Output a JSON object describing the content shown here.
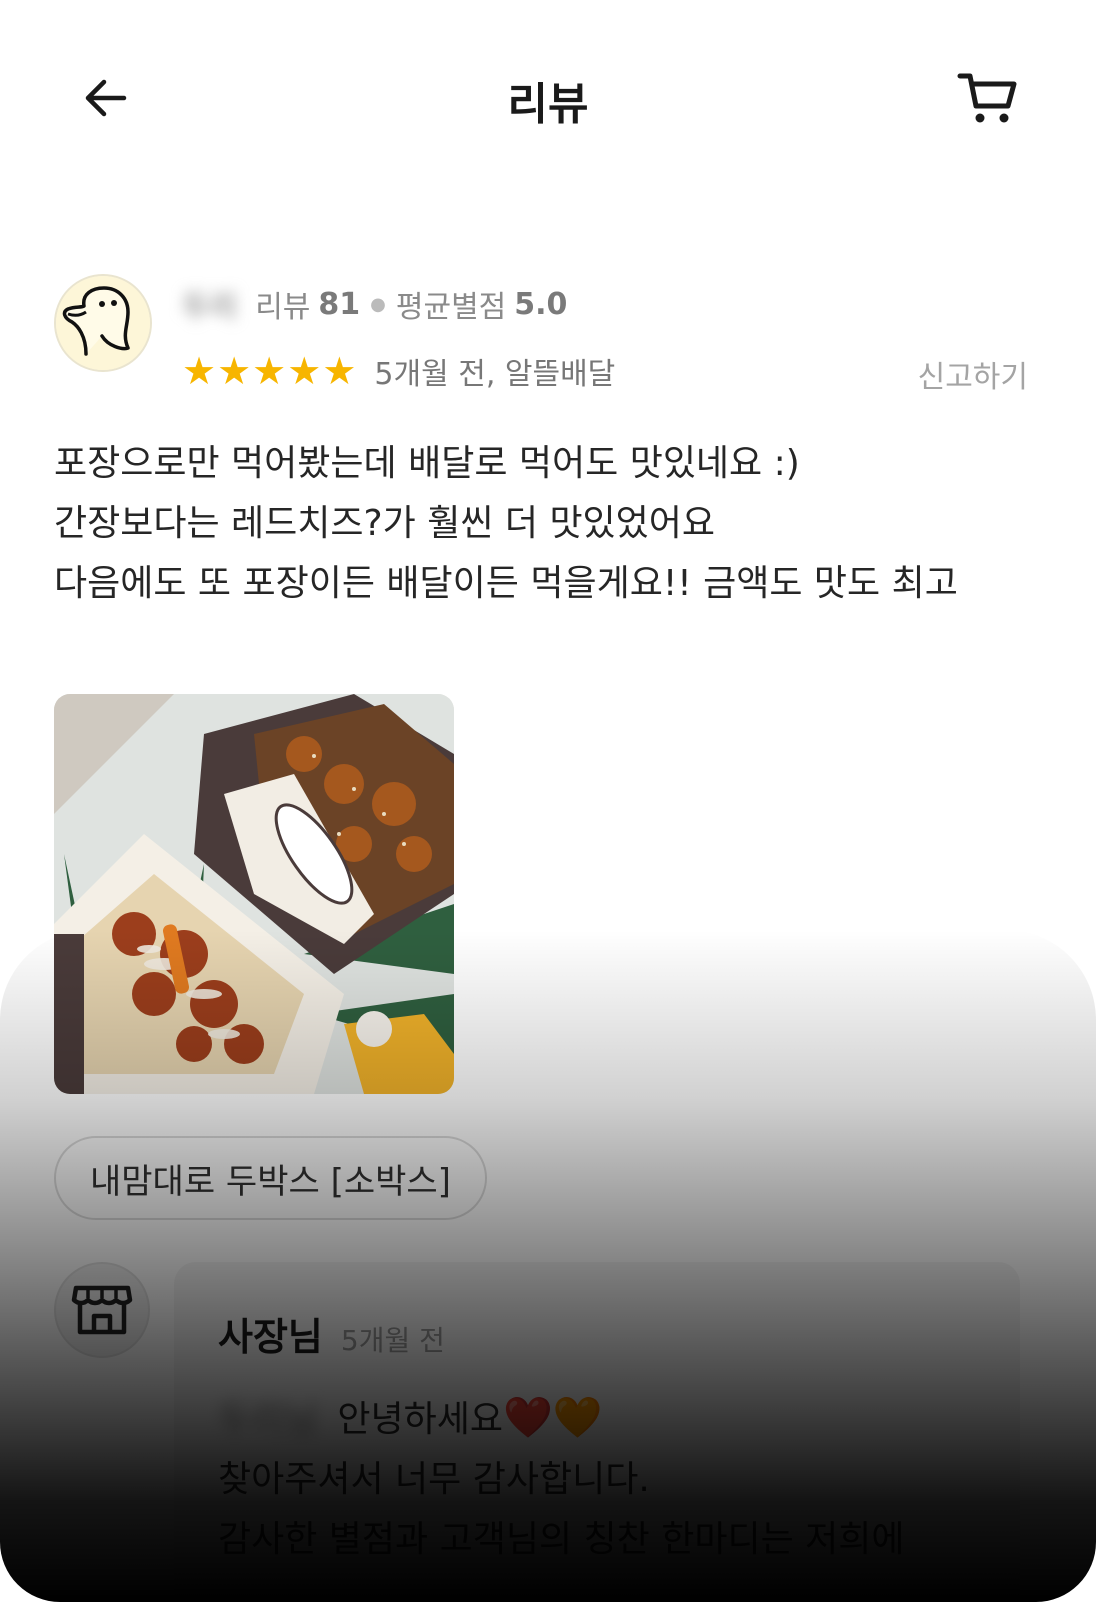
{
  "header": {
    "title": "리뷰",
    "back_icon": "arrow-left-icon",
    "cart_icon": "cart-icon"
  },
  "review": {
    "user_name": "두리",
    "review_label": "리뷰",
    "review_count": "81",
    "avg_label": "평균별점",
    "avg_rating": "5.0",
    "rating": 5,
    "meta": "5개월 전, 알뜰배달",
    "report_label": "신고하기",
    "text": "포장으로만 먹어봤는데 배달로 먹어도 맛있네요 :)\n간장보다는 레드치즈?가 훨씬 더 맛있었어요\n다음에도 또 포장이든 배달이든 먹을게요!! 금액도 맛도 최고",
    "menu_chip": "내맘대로 두박스 [소박스]",
    "star_color": "#f7b500"
  },
  "owner_reply": {
    "name": "사장님",
    "time": "5개월 전",
    "greeting_name": "두리님",
    "line1": "안녕하세요",
    "hearts": "❤️🧡",
    "line2": "찾아주셔서 너무 감사합니다.",
    "line3": "감사한 별점과 고객님의 칭찬 한마디는 저희에"
  }
}
